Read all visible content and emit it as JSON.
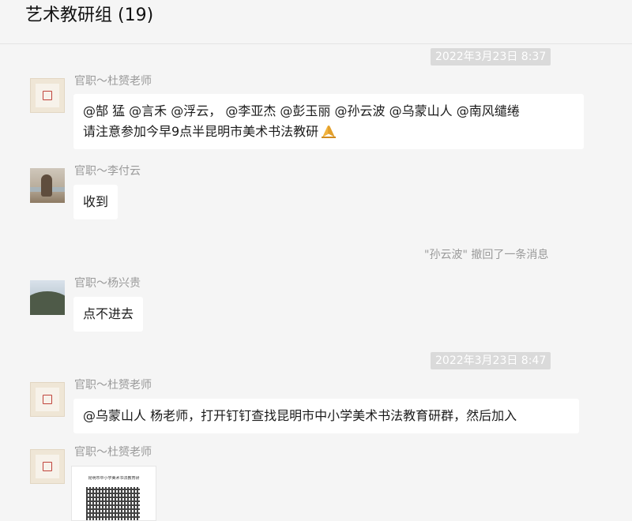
{
  "header": {
    "title": "艺术教研组 (19)"
  },
  "messages": {
    "time1": "2022年3月23日 8:37",
    "m1": {
      "avatar_icon": "seal-stamp-avatar",
      "sender": "官职～杜赟老师",
      "line1": "@郜 猛 @言禾 @浮云， @李亚杰 @彭玉丽 @孙云波 @乌蒙山人 @南风缱绻",
      "line2": "请注意参加今早9点半昆明市美术书法教研",
      "emoji": "folded-hands-emoji"
    },
    "m2": {
      "avatar_icon": "beach-photo-avatar",
      "sender": "官职～李付云",
      "text": "收到"
    },
    "recall": "\"孙云波\" 撤回了一条消息",
    "m3": {
      "avatar_icon": "landscape-photo-avatar",
      "sender": "官职～杨兴贵",
      "text": "点不进去"
    },
    "time2": "2022年3月23日 8:47",
    "m4": {
      "avatar_icon": "seal-stamp-avatar",
      "sender": "官职～杜赟老师",
      "text": "@乌蒙山人 杨老师，打开钉钉查找昆明市中小学美术书法教育研群，然后加入"
    },
    "m5": {
      "avatar_icon": "seal-stamp-avatar",
      "sender": "官职～杜赟老师",
      "image_caption": "昆明市中小学美术书法教育研",
      "image_subcaption": "",
      "image_icon": "qr-code-image"
    }
  }
}
